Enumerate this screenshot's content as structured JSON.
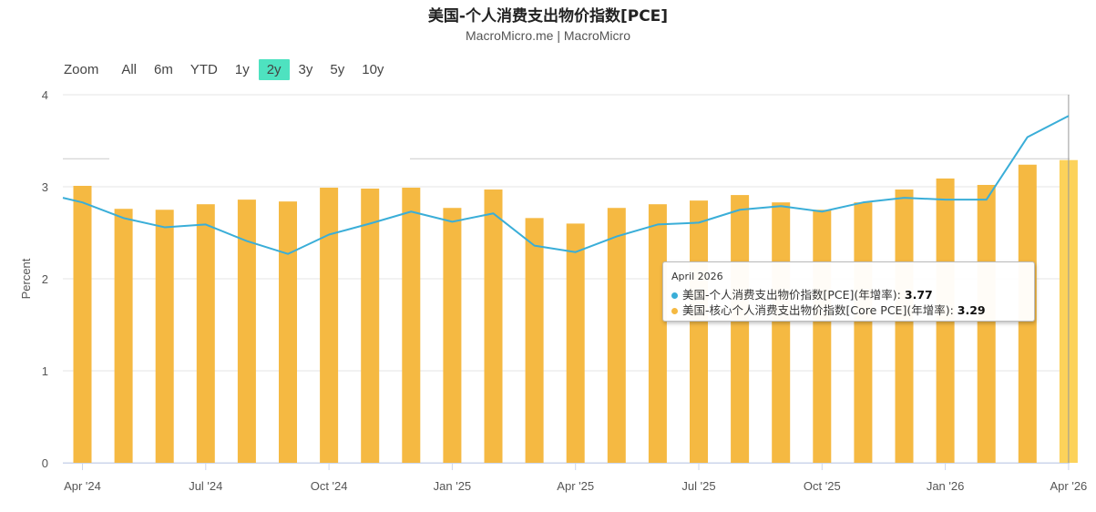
{
  "header": {
    "title": "美国-个人消费支出物价指数[PCE]",
    "subtitle": "MacroMicro.me | MacroMicro"
  },
  "zoom": {
    "label": "Zoom",
    "buttons": [
      "All",
      "6m",
      "YTD",
      "1y",
      "2y",
      "3y",
      "5y",
      "10y"
    ],
    "active": "2y"
  },
  "chart_data": {
    "type": "bar",
    "ylabel": "Percent",
    "xlabel": "",
    "ylim": [
      0,
      4
    ],
    "yticks": [
      0,
      1,
      2,
      3,
      4
    ],
    "grid": true,
    "categories": [
      "Apr 2024",
      "May 2024",
      "Jun 2024",
      "Jul 2024",
      "Aug 2024",
      "Sep 2024",
      "Oct 2024",
      "Nov 2024",
      "Dec 2024",
      "Jan 2025",
      "Feb 2025",
      "Mar 2025",
      "Apr 2025",
      "May 2025",
      "Jun 2025",
      "Jul 2025",
      "Aug 2025",
      "Sep 2025",
      "Oct 2025",
      "Nov 2025",
      "Dec 2025",
      "Jan 2026",
      "Feb 2026",
      "Mar 2026",
      "Apr 2026"
    ],
    "x_tick_labels": [
      {
        "index": 0,
        "label": "Apr '24"
      },
      {
        "index": 3,
        "label": "Jul '24"
      },
      {
        "index": 6,
        "label": "Oct '24"
      },
      {
        "index": 9,
        "label": "Jan '25"
      },
      {
        "index": 12,
        "label": "Apr '25"
      },
      {
        "index": 15,
        "label": "Jul '25"
      },
      {
        "index": 18,
        "label": "Oct '25"
      },
      {
        "index": 21,
        "label": "Jan '26"
      },
      {
        "index": 24,
        "label": "Apr '26"
      }
    ],
    "series": [
      {
        "name": "美国-核心个人消费支出物价指数[Core PCE](年增率)",
        "type": "bar",
        "color": "#f5b942",
        "highlight_color": "#fcd25a",
        "values": [
          3.01,
          2.76,
          2.75,
          2.81,
          2.86,
          2.84,
          2.99,
          2.98,
          2.99,
          2.77,
          2.97,
          2.66,
          2.6,
          2.77,
          2.81,
          2.85,
          2.91,
          2.83,
          2.75,
          2.83,
          2.97,
          3.09,
          3.02,
          3.24,
          3.29
        ]
      },
      {
        "name": "美国-个人消费支出物价指数[PCE](年增率)",
        "type": "line",
        "color": "#3aaed8",
        "values": [
          2.83,
          2.66,
          2.56,
          2.59,
          2.41,
          2.27,
          2.48,
          2.6,
          2.73,
          2.62,
          2.71,
          2.36,
          2.29,
          2.46,
          2.59,
          2.61,
          2.75,
          2.79,
          2.73,
          2.83,
          2.88,
          2.86,
          2.86,
          3.54,
          3.77
        ],
        "start_value": 2.88
      }
    ],
    "reference_line": {
      "value": 3.29
    },
    "tooltip": {
      "date": "April 2026",
      "pce_label": "美国-个人消费支出物价指数[PCE](年增率): ",
      "pce_value": "3.77",
      "core_label": "美国-核心个人消费支出物价指数[Core PCE](年增率): ",
      "core_value": "3.29"
    }
  }
}
